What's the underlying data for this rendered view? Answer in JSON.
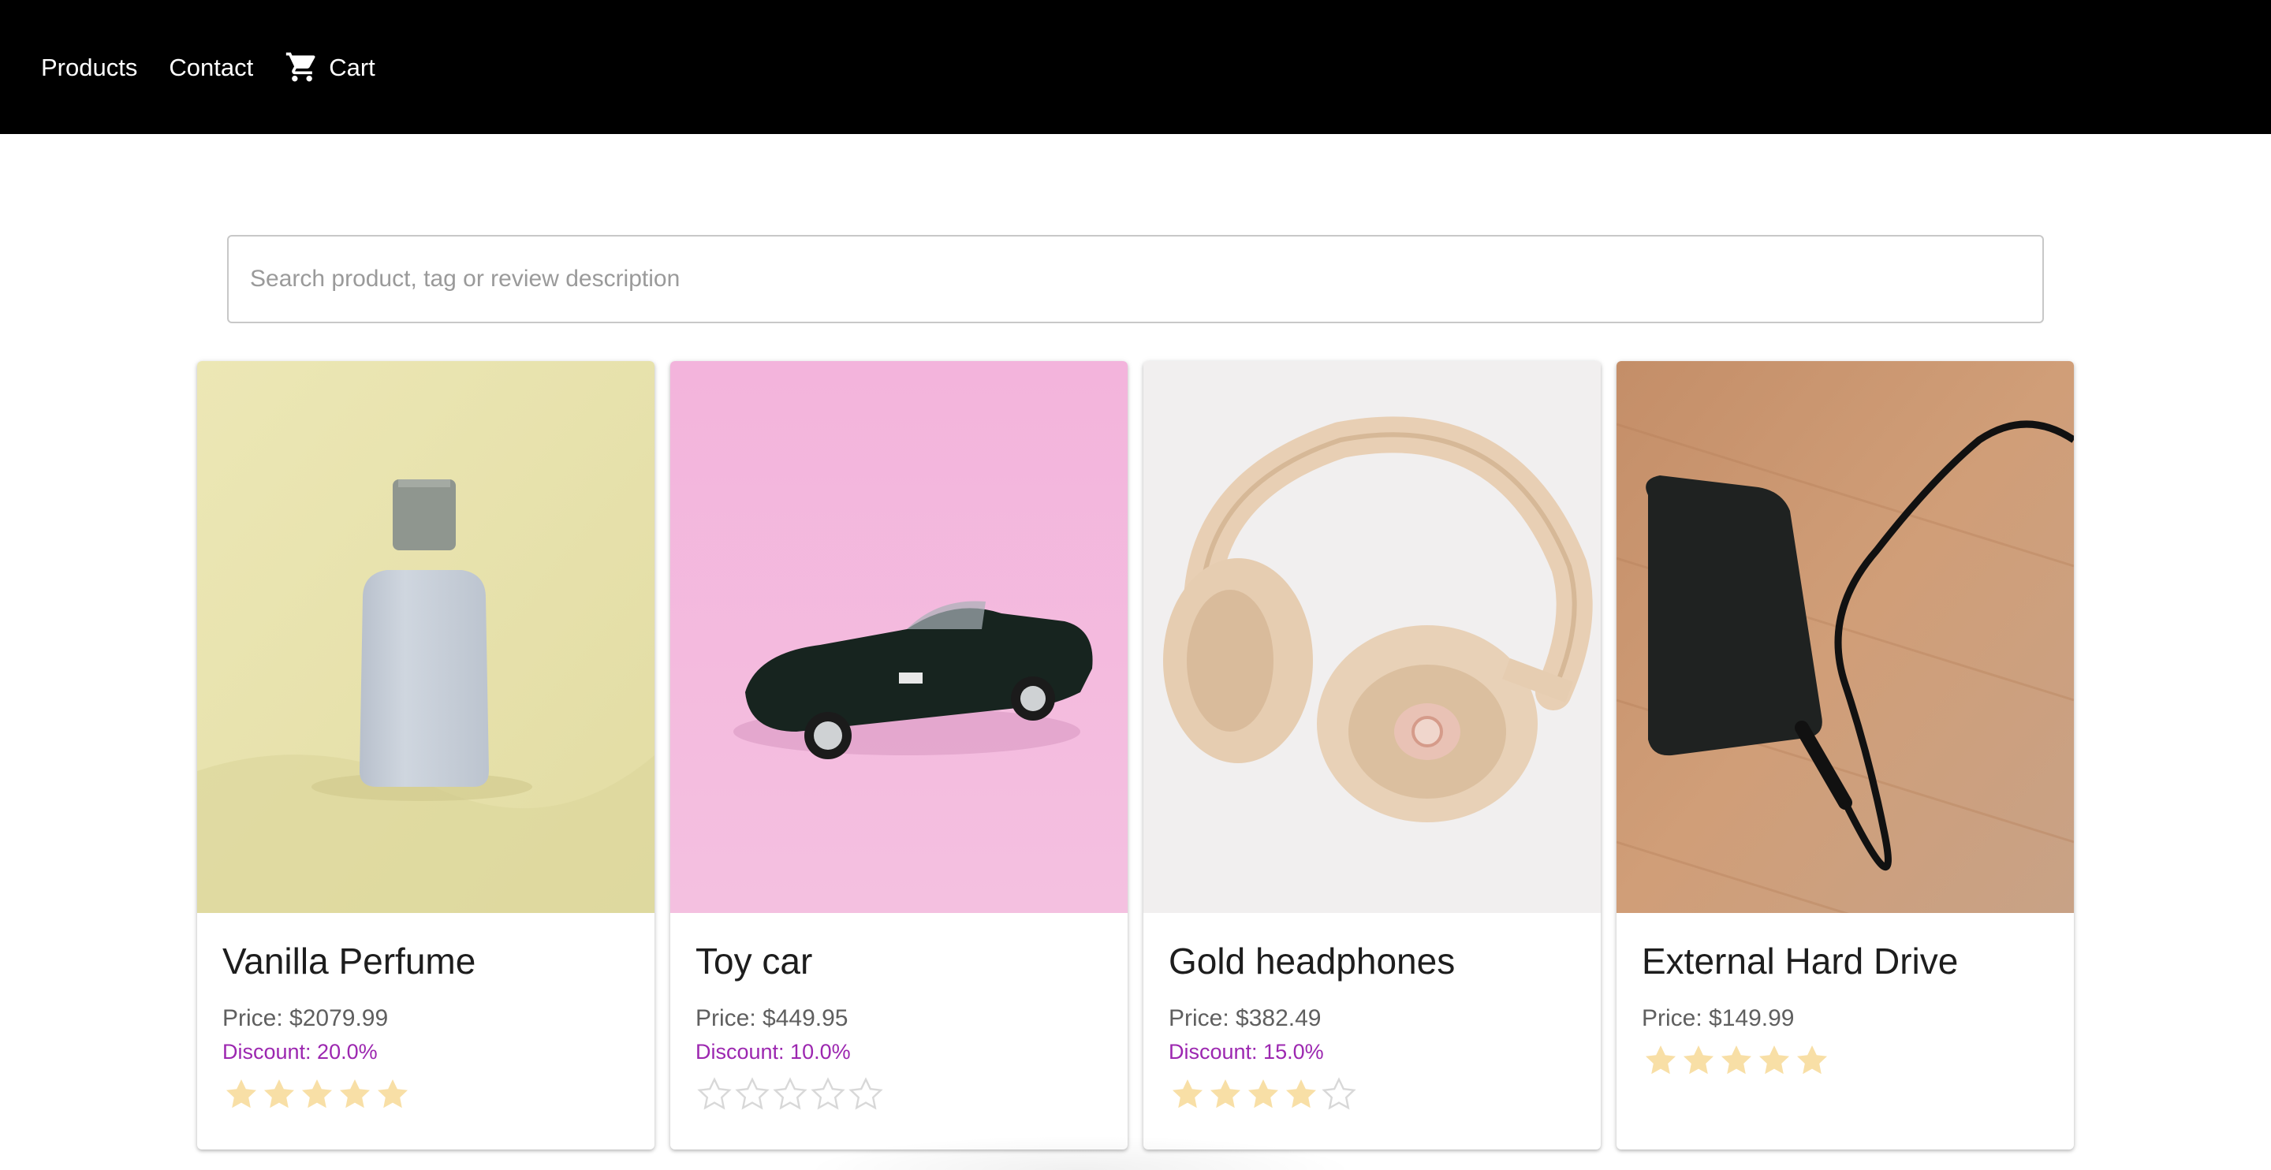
{
  "nav": {
    "products_label": "Products",
    "contact_label": "Contact",
    "cart_label": "Cart",
    "cart_icon": "shopping-cart-icon"
  },
  "search": {
    "placeholder": "Search product, tag or review description",
    "value": ""
  },
  "colors": {
    "appbar": "#000000",
    "discount": "#9c27b0",
    "star_filled": "#f8dfa6",
    "star_empty": "#d8d8d8"
  },
  "products": [
    {
      "title": "Vanilla Perfume",
      "price": "Price: $2079.99",
      "discount": "Discount: 20.0%",
      "rating": 5,
      "image": "perfume-bottle-image"
    },
    {
      "title": "Toy car",
      "price": "Price: $449.95",
      "discount": "Discount: 10.0%",
      "rating": 0,
      "image": "toy-car-image"
    },
    {
      "title": "Gold headphones",
      "price": "Price: $382.49",
      "discount": "Discount: 15.0%",
      "rating": 4,
      "image": "headphones-image"
    },
    {
      "title": "External Hard Drive",
      "price": "Price: $149.99",
      "discount": "",
      "rating": 5,
      "image": "hard-drive-image"
    }
  ]
}
